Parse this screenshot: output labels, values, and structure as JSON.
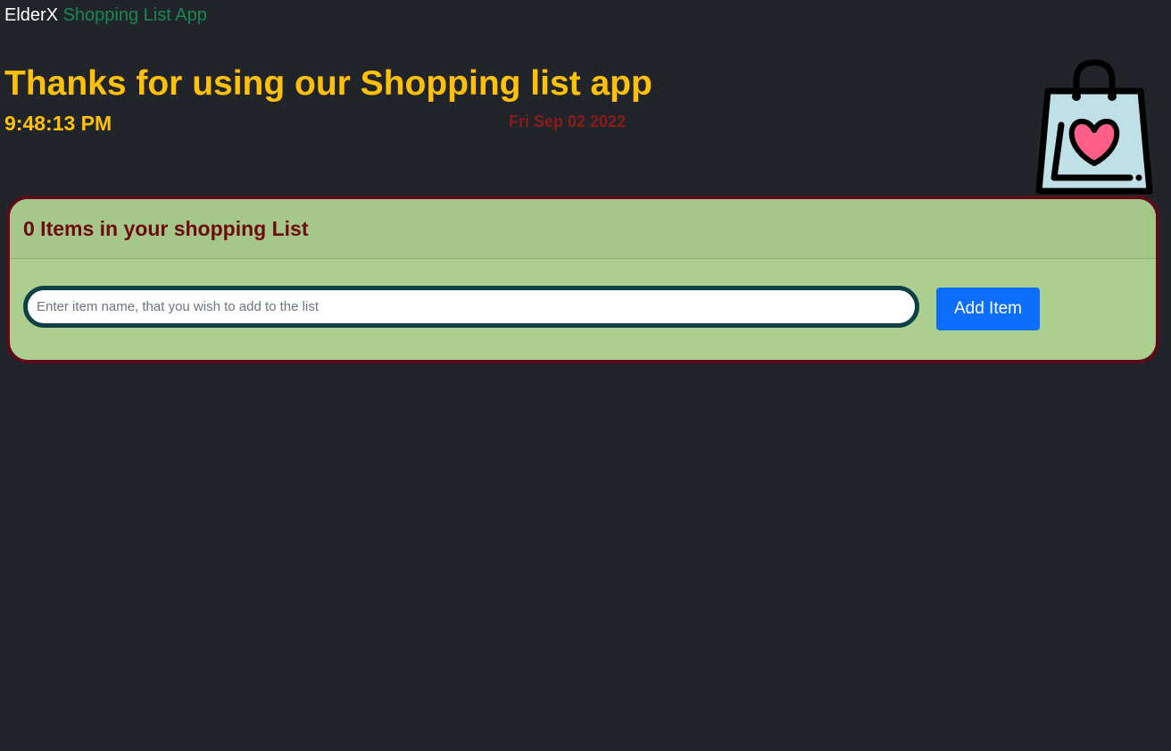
{
  "brand": {
    "name": "ElderX",
    "subtitle": "Shopping List App"
  },
  "header": {
    "headline": "Thanks for using our Shopping list app",
    "time": "9:48:13 PM",
    "date": "Fri Sep 02 2022",
    "icon": "shopping-bag-heart-icon"
  },
  "card": {
    "title": "0 Items in your shopping List",
    "input": {
      "value": "",
      "placeholder": "Enter item name, that you wish to add to the list"
    },
    "add_button_label": "Add Item"
  },
  "colors": {
    "background": "#212529",
    "brand_sub": "#198754",
    "headline": "#ffc107",
    "date": "#8b1a1a",
    "card_border": "#5c0a1c",
    "card_background": "#accf8f",
    "card_title": "#6b0b0b",
    "input_border": "#0e4145",
    "button": "#0d6efd",
    "bag_fill": "#bfe0e6",
    "heart": "#ff5f8a"
  }
}
